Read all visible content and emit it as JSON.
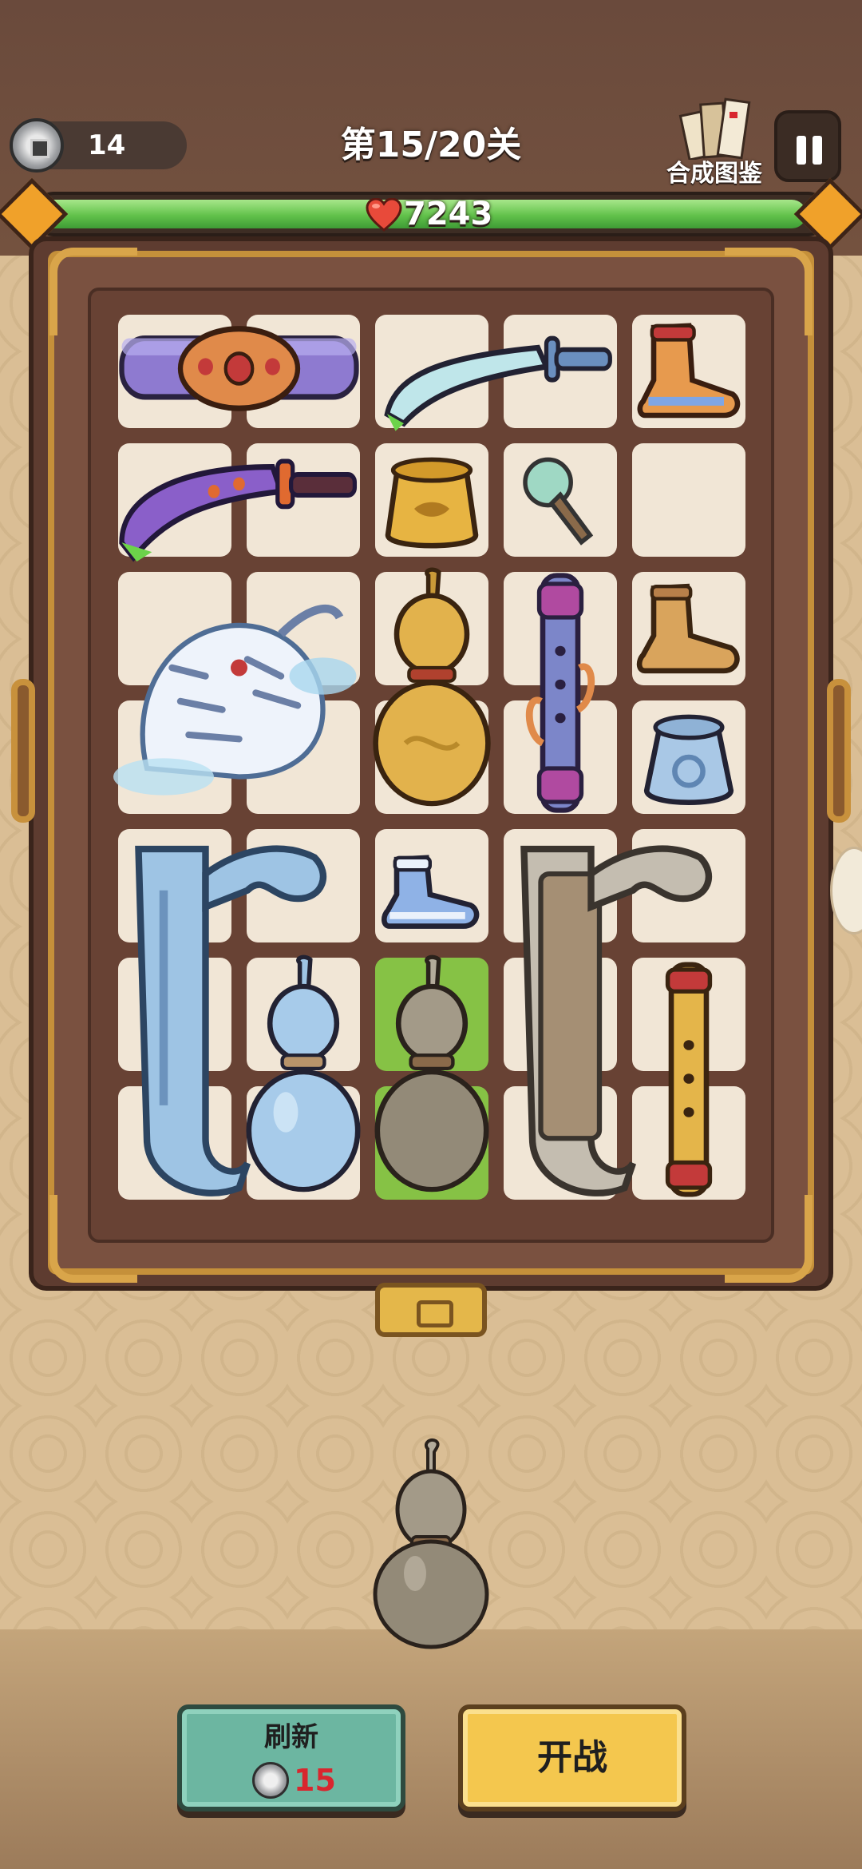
{
  "hud": {
    "coins": "14",
    "level_title": "第15/20关",
    "codex_label": "合成图鉴",
    "hp": "7243",
    "hp_fill_fraction": 0.98
  },
  "board": {
    "rows": 7,
    "cols": 5,
    "highlighted_cells": [
      [
        5,
        2
      ],
      [
        6,
        2
      ]
    ],
    "items": [
      {
        "name": "purple-belt",
        "row": 0,
        "col": 0,
        "w": 2,
        "h": 1
      },
      {
        "name": "blue-sword",
        "row": 0,
        "col": 2,
        "w": 2,
        "h": 1
      },
      {
        "name": "orange-boot",
        "row": 0,
        "col": 4,
        "w": 1,
        "h": 1
      },
      {
        "name": "purple-sword",
        "row": 1,
        "col": 0,
        "w": 2,
        "h": 1
      },
      {
        "name": "gold-pouch",
        "row": 1,
        "col": 2,
        "w": 1,
        "h": 1
      },
      {
        "name": "teal-brush",
        "row": 1,
        "col": 3,
        "w": 1,
        "h": 1
      },
      {
        "name": "white-tiger",
        "row": 2,
        "col": 0,
        "w": 2,
        "h": 2
      },
      {
        "name": "gold-gourd",
        "row": 2,
        "col": 2,
        "w": 1,
        "h": 2
      },
      {
        "name": "purple-flute",
        "row": 2,
        "col": 3,
        "w": 1,
        "h": 2
      },
      {
        "name": "brown-boot",
        "row": 2,
        "col": 4,
        "w": 1,
        "h": 1
      },
      {
        "name": "blue-pouch",
        "row": 3,
        "col": 4,
        "w": 1,
        "h": 1
      },
      {
        "name": "blue-wing-staff",
        "row": 4,
        "col": 0,
        "w": 2,
        "h": 3
      },
      {
        "name": "blue-boot",
        "row": 4,
        "col": 2,
        "w": 1,
        "h": 1
      },
      {
        "name": "grey-wing-staff",
        "row": 4,
        "col": 3,
        "w": 2,
        "h": 3
      },
      {
        "name": "blue-gourd",
        "row": 5,
        "col": 1,
        "w": 1,
        "h": 2
      },
      {
        "name": "grey-gourd",
        "row": 5,
        "col": 2,
        "w": 1,
        "h": 2
      },
      {
        "name": "gold-flute",
        "row": 5,
        "col": 4,
        "w": 1,
        "h": 2
      }
    ]
  },
  "staging_item": "grey-gourd",
  "buttons": {
    "refresh_label": "刷新",
    "refresh_cost": "15",
    "start_label": "开战"
  },
  "colors": {
    "hp_green": "#62c24b",
    "refresh_teal": "#6cb6a1",
    "start_yellow": "#f4c74e",
    "cost_red": "#d8262e",
    "cell_bg": "#f1e6d6",
    "cell_highlight": "#86c245"
  }
}
